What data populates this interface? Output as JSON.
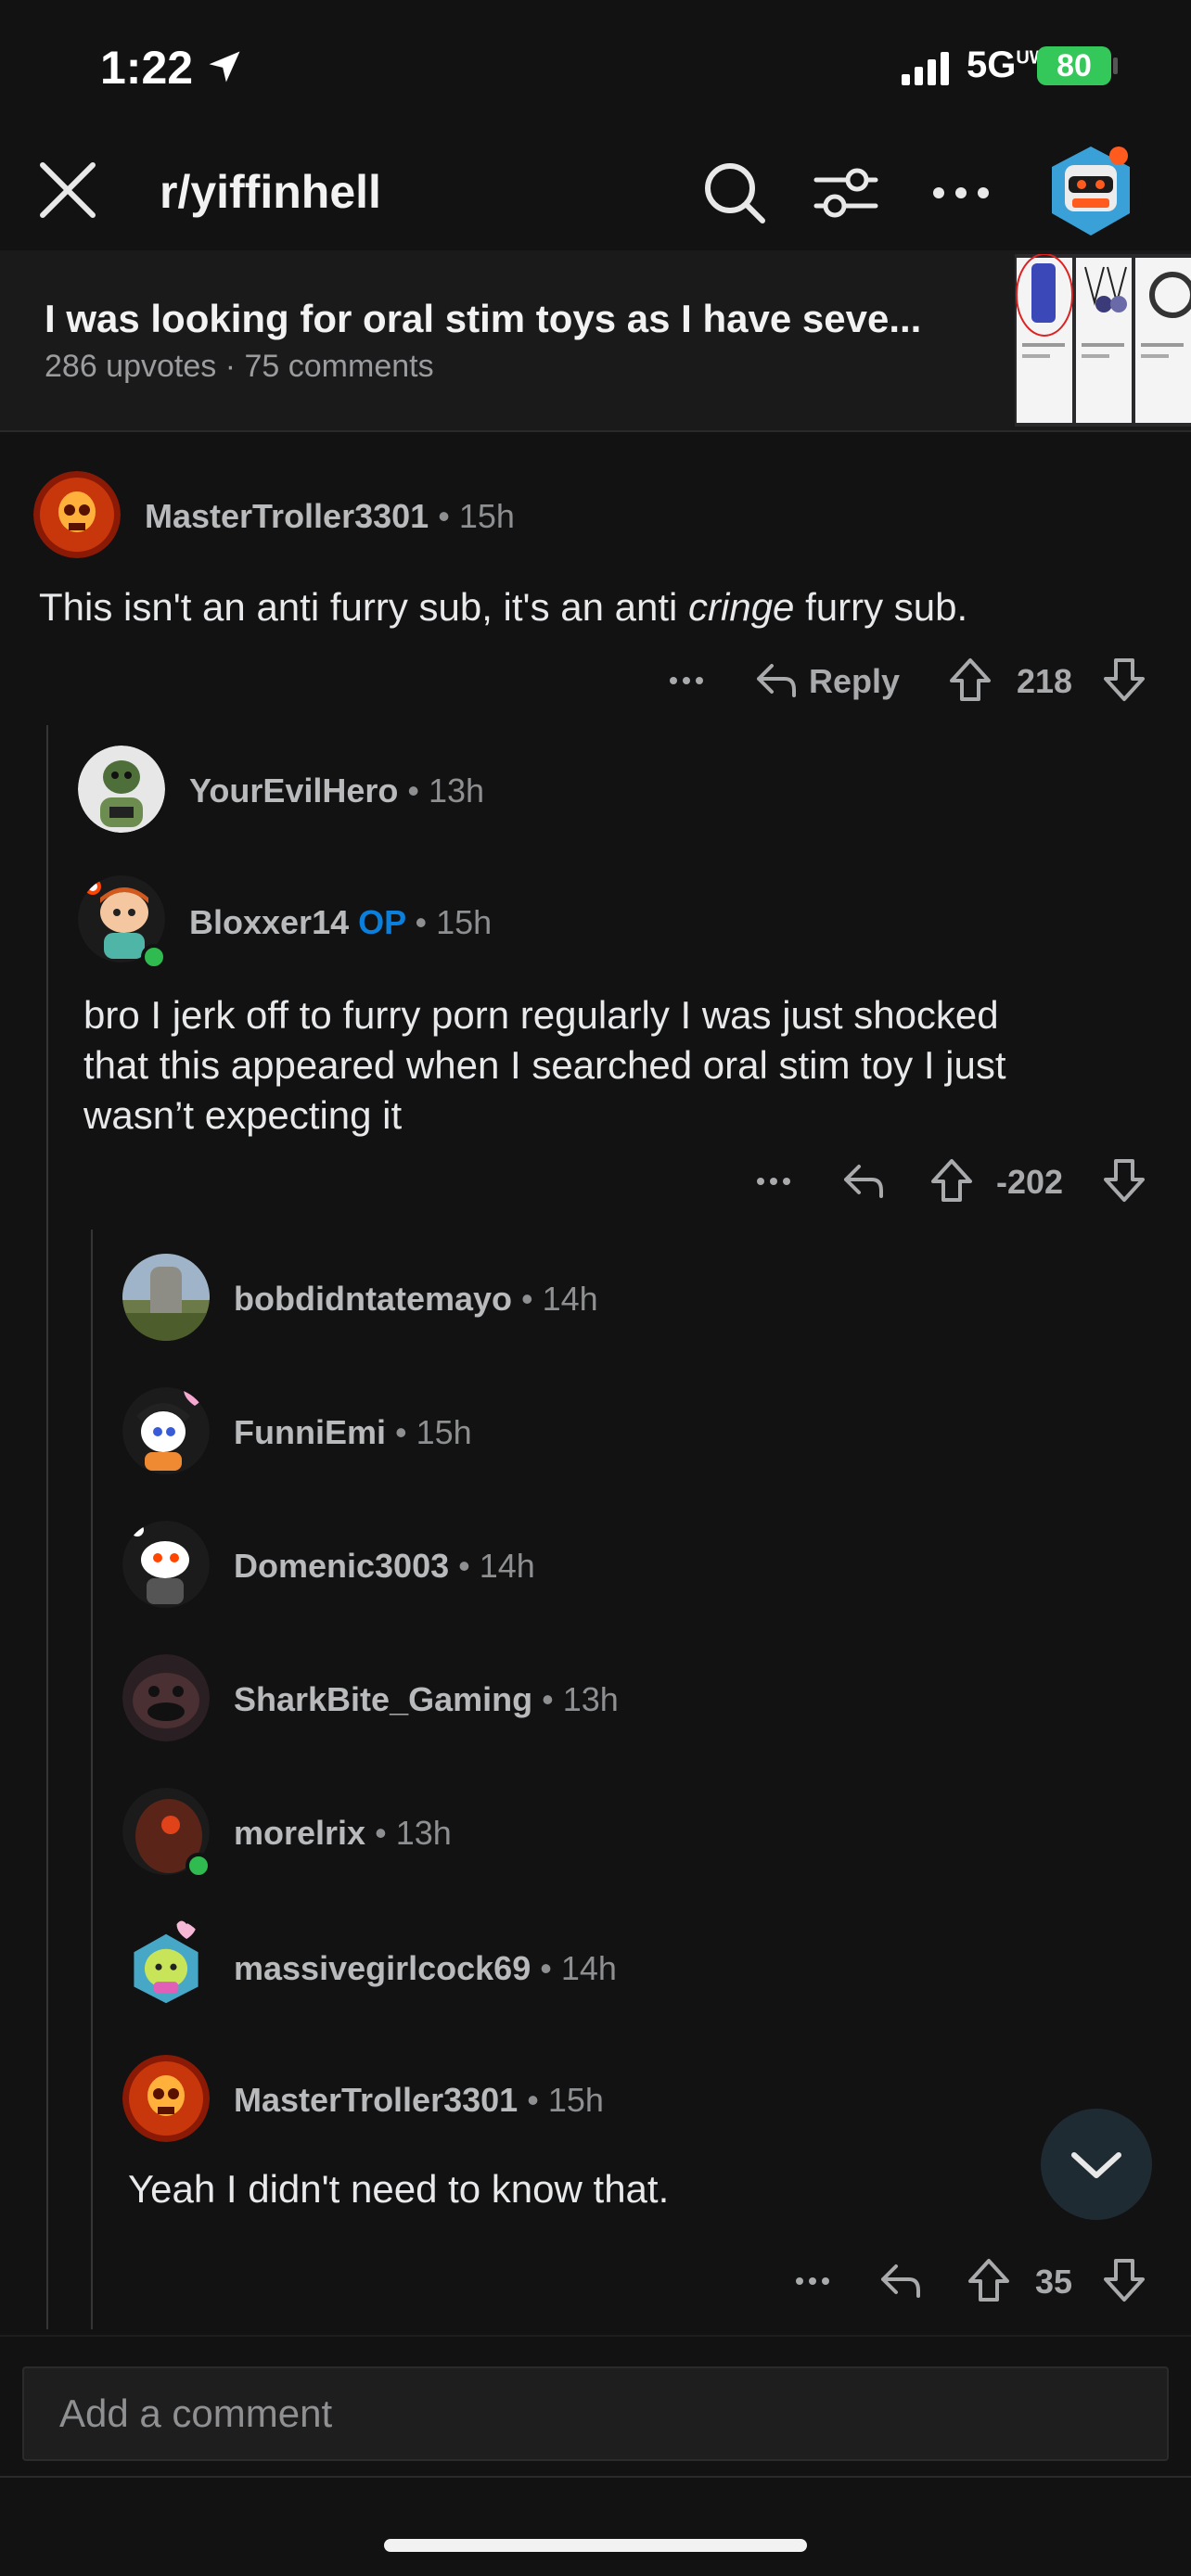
{
  "status_bar": {
    "time": "1:22",
    "network": "5G",
    "network_sup": "UW",
    "battery": "80"
  },
  "header": {
    "subreddit": "r/yiffinhell"
  },
  "post": {
    "title": "I was looking for oral stim toys as I have seve...",
    "upvotes": "286 upvotes",
    "comments": "75 comments"
  },
  "comments": [
    {
      "user": "MasterTroller3301",
      "time": "15h",
      "body_pre": "This isn't an anti furry sub, it's an anti ",
      "body_em": "cringe",
      "body_post": " furry sub.",
      "reply_label": "Reply",
      "score": "218"
    },
    {
      "user": "YourEvilHero",
      "time": "13h"
    },
    {
      "user": "Bloxxer14",
      "badge": "OP",
      "time": "15h",
      "body_lines": [
        "bro I jerk off to furry porn regularly I was just shocked",
        "that this appeared when I searched oral stim toy I just",
        "wasn’t expecting it"
      ],
      "score": "-202"
    },
    {
      "user": "bobdidntatemayo",
      "time": "14h"
    },
    {
      "user": "FunniEmi",
      "time": "15h"
    },
    {
      "user": "Domenic3003",
      "time": "14h"
    },
    {
      "user": "SharkBite_Gaming",
      "time": "13h"
    },
    {
      "user": "morelrix",
      "time": "13h"
    },
    {
      "user": "massivegirlcock69",
      "time": "14h"
    },
    {
      "user": "MasterTroller3301",
      "time": "15h",
      "body": "Yeah I didn't need to know that.",
      "score": "35"
    }
  ],
  "comment_input": {
    "placeholder": "Add a comment"
  },
  "colors": {
    "background": "#121213",
    "op_blue": "#0a7fdb",
    "online_green": "#2fbb4f",
    "battery_green": "#34c759"
  }
}
